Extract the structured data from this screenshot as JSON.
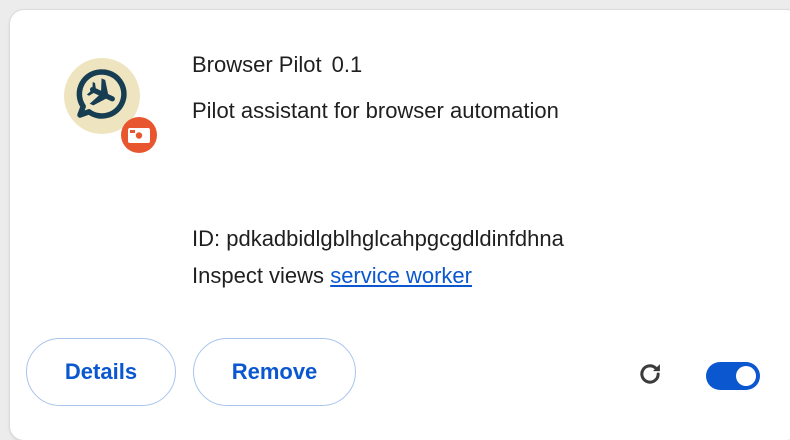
{
  "extension": {
    "name": "Browser Pilot",
    "version": "0.1",
    "description": "Pilot assistant for browser automation",
    "id_text": "ID: pdkadbidlgblhglcahpgcgdldinfdhna",
    "inspect_label": "Inspect views",
    "inspect_link": "service worker"
  },
  "actions": {
    "details_label": "Details",
    "remove_label": "Remove"
  },
  "toggle": {
    "enabled": true
  },
  "icons": {
    "logo": "browser-pilot-logo",
    "badge": "unpacked-extension-badge-icon",
    "reload": "reload-icon"
  },
  "colors": {
    "accent": "#0b57d0",
    "logo_bg": "#eee5c0",
    "logo_mark": "#163d52",
    "badge": "#e8562f",
    "button_border": "#a8c4ee",
    "text": "#1f1f1f"
  }
}
